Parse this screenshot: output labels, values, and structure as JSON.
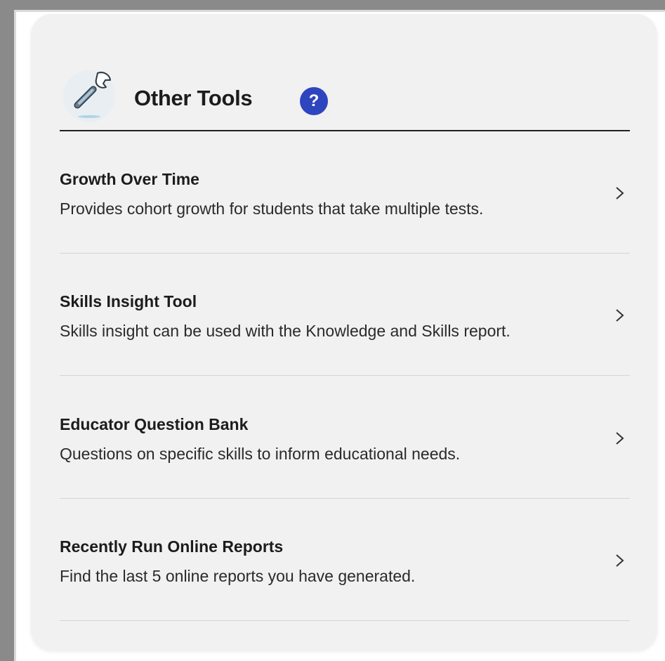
{
  "header": {
    "title": "Other Tools",
    "help_glyph": "?",
    "icon": "wrench-icon",
    "help_icon": "question-circle-icon"
  },
  "colors": {
    "card_background": "#f1f1f1",
    "help_badge": "#2e45c0",
    "title_text": "#1c1c1c",
    "divider": "#d4d4d4"
  },
  "items": [
    {
      "title": "Growth Over Time",
      "description": "Provides cohort growth for students that take multiple tests.",
      "icon": "chevron-right-icon"
    },
    {
      "title": "Skills Insight Tool",
      "description": "Skills insight can be used with the Knowledge and Skills report.",
      "icon": "chevron-right-icon"
    },
    {
      "title": "Educator Question Bank",
      "description": "Questions on specific skills to inform educational needs.",
      "icon": "chevron-right-icon"
    },
    {
      "title": "Recently Run Online Reports",
      "description": "Find the last 5 online reports you have generated.",
      "icon": "chevron-right-icon"
    }
  ]
}
